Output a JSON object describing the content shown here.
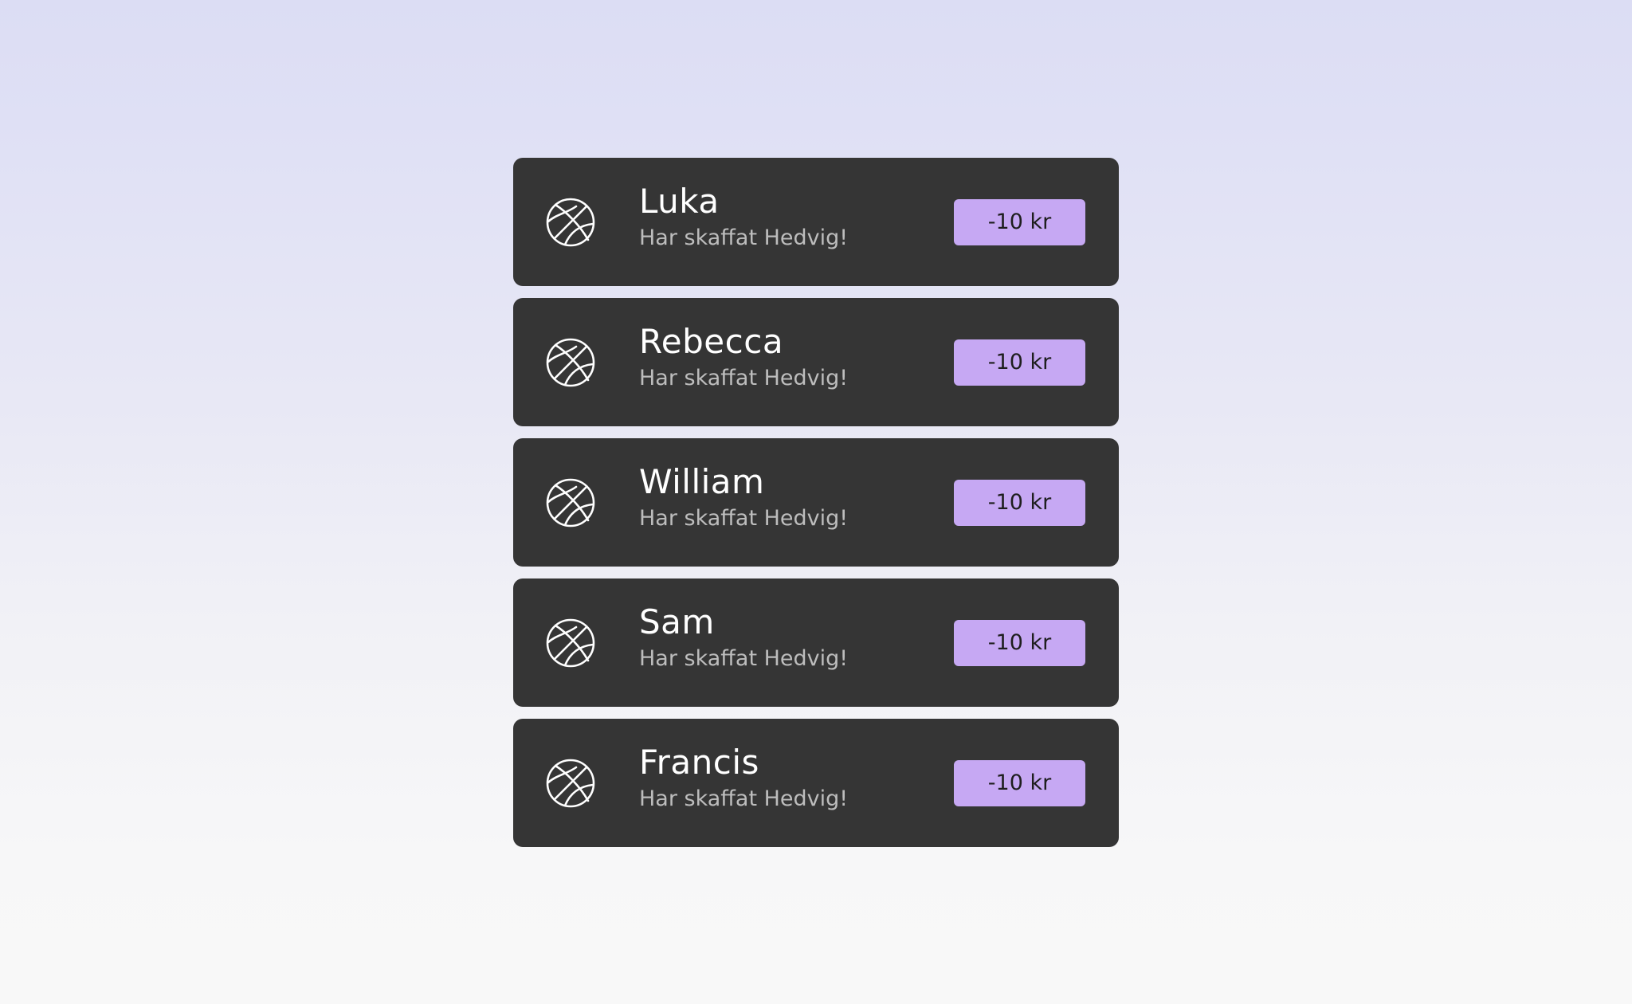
{
  "items": [
    {
      "name": "Luka",
      "subtitle": "Har skaffat Hedvig!",
      "badge": "-10 kr",
      "icon": "basketball-icon"
    },
    {
      "name": "Rebecca",
      "subtitle": "Har skaffat Hedvig!",
      "badge": "-10 kr",
      "icon": "basketball-icon"
    },
    {
      "name": "William",
      "subtitle": "Har skaffat Hedvig!",
      "badge": "-10 kr",
      "icon": "basketball-icon"
    },
    {
      "name": "Sam",
      "subtitle": "Har skaffat Hedvig!",
      "badge": "-10 kr",
      "icon": "basketball-icon"
    },
    {
      "name": "Francis",
      "subtitle": "Har skaffat Hedvig!",
      "badge": "-10 kr",
      "icon": "basketball-icon"
    }
  ],
  "colors": {
    "card_background": "#353535",
    "badge_background": "#c6a8f3",
    "name_text": "#ffffff",
    "subtitle_text": "#bdbdbd",
    "page_gradient_top": "#dcddf4",
    "page_gradient_bottom": "#f8f8f8"
  }
}
